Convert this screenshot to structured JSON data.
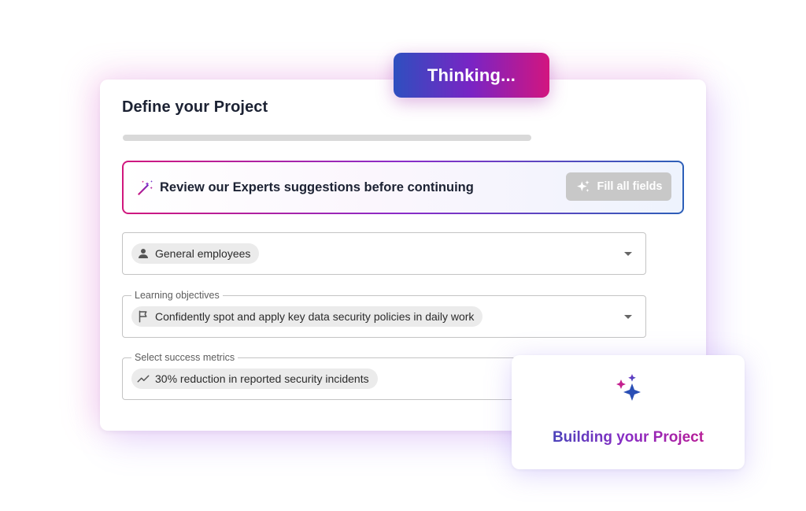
{
  "card": {
    "title": "Define your Project"
  },
  "progress": {
    "value": 0
  },
  "banner": {
    "icon": "magic-wand-icon",
    "text": "Review our Experts suggestions before continuing",
    "button_label": "Fill all fields",
    "button_icon": "sparkle-icon"
  },
  "fields": {
    "audience": {
      "label": "",
      "icon": "person-icon",
      "value": "General employees"
    },
    "objectives": {
      "label": "Learning objectives",
      "icon": "flag-icon",
      "value": "Confidently spot and apply key data security policies in daily work"
    },
    "metrics": {
      "label": "Select success metrics",
      "icon": "trending-up-icon",
      "value": "30% reduction in reported security incidents"
    }
  },
  "thinking": {
    "label": "Thinking..."
  },
  "building": {
    "icon": "sparkles-icon",
    "label": "Building your Project"
  },
  "colors": {
    "brand_pink": "#d1177d",
    "brand_purple": "#8a2cc9",
    "brand_blue": "#2c5fb8",
    "title_text": "#1c2233",
    "chip_bg": "#ebebeb",
    "disabled_button": "#c8c8c8"
  }
}
